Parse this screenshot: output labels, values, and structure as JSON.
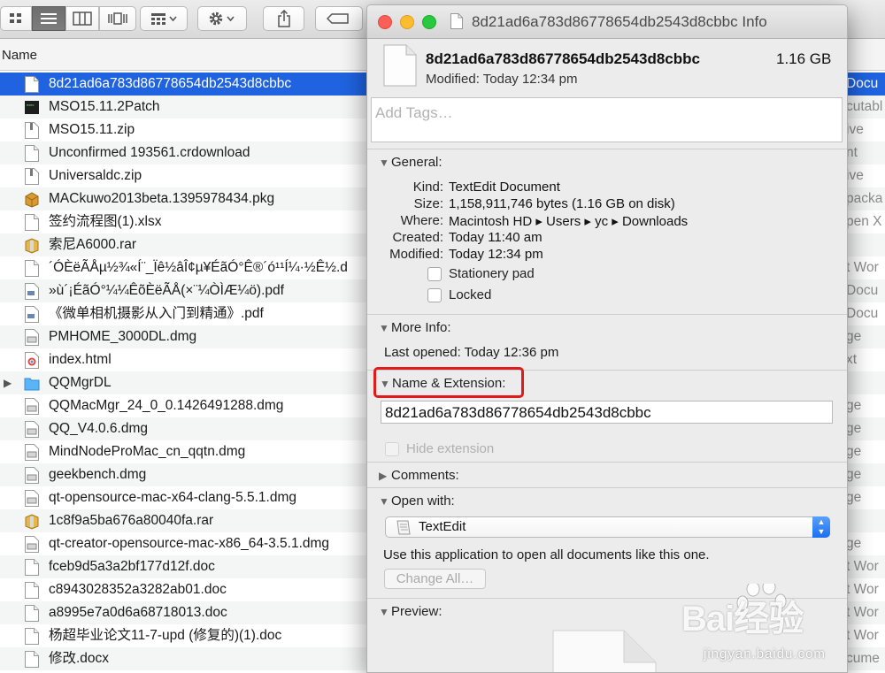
{
  "finder": {
    "column_header": "Name",
    "rows": [
      {
        "name": "8d21ad6a783d86778654db2543d8cbbc",
        "kind": "Docu",
        "icon": "document-icon",
        "selected": true
      },
      {
        "name": "MSO15.11.2Patch",
        "kind": "cutabl",
        "icon": "terminal-exec-icon"
      },
      {
        "name": "MSO15.11.zip",
        "kind": "ive",
        "icon": "zip-icon"
      },
      {
        "name": "Unconfirmed 193561.crdownload",
        "kind": "nt",
        "icon": "document-icon"
      },
      {
        "name": "Universaldc.zip",
        "kind": "ive",
        "icon": "zip-icon"
      },
      {
        "name": "MACkuwo2013beta.1395978434.pkg",
        "kind": "packa",
        "icon": "package-icon"
      },
      {
        "name": "签约流程图(1).xlsx",
        "kind": "pen X",
        "icon": "document-icon"
      },
      {
        "name": "索尼A6000.rar",
        "kind": "",
        "icon": "archive-box-icon"
      },
      {
        "name": "´ÓÈëÃÅµ½¾«Í¨_Ïê½âÎ¢µ¥ÉãÓ°Ê®´ó¹¹Í¼·½Ê½.d",
        "kind": "t Wor",
        "icon": "document-icon"
      },
      {
        "name": "»ù´¡ÉãÓ°¼¼ÊõÈëÃÅ(×¨¼ÒÌÆ¼ö).pdf",
        "kind": "Docu",
        "icon": "pdf-icon"
      },
      {
        "name": "《微单相机摄影从入门到精通》.pdf",
        "kind": "Docu",
        "icon": "pdf-icon"
      },
      {
        "name": "PMHOME_3000DL.dmg",
        "kind": "ge",
        "icon": "disk-image-icon"
      },
      {
        "name": "index.html",
        "kind": "xt",
        "icon": "chrome-html-icon"
      },
      {
        "name": "QQMgrDL",
        "kind": "",
        "icon": "folder-icon",
        "folder": true
      },
      {
        "name": "QQMacMgr_24_0_0.1426491288.dmg",
        "kind": "ge",
        "icon": "disk-image-icon"
      },
      {
        "name": "QQ_V4.0.6.dmg",
        "kind": "ge",
        "icon": "disk-image-icon"
      },
      {
        "name": "MindNodeProMac_cn_qqtn.dmg",
        "kind": "ge",
        "icon": "disk-image-icon"
      },
      {
        "name": "geekbench.dmg",
        "kind": "ge",
        "icon": "disk-image-icon"
      },
      {
        "name": "qt-opensource-mac-x64-clang-5.5.1.dmg",
        "kind": "ge",
        "icon": "disk-image-icon"
      },
      {
        "name": "1c8f9a5ba676a80040fa.rar",
        "kind": "",
        "icon": "archive-box-icon"
      },
      {
        "name": "qt-creator-opensource-mac-x86_64-3.5.1.dmg",
        "kind": "ge",
        "icon": "disk-image-icon"
      },
      {
        "name": "fceb9d5a3a2bf177d12f.doc",
        "kind": "t Wor",
        "icon": "document-icon"
      },
      {
        "name": "c8943028352a3282ab01.doc",
        "kind": "t Wor",
        "icon": "document-icon"
      },
      {
        "name": "a8995e7a0d6a68718013.doc",
        "kind": "t Wor",
        "icon": "document-icon"
      },
      {
        "name": "杨超毕业论文11-7-upd (修复的)(1).doc",
        "kind": "t Wor",
        "icon": "document-icon"
      },
      {
        "name": "修改.docx",
        "kind": "cume",
        "icon": "document-icon"
      }
    ]
  },
  "info_window": {
    "title": "8d21ad6a783d86778654db2543d8cbbc Info",
    "file_name": "8d21ad6a783d86778654db2543d8cbbc",
    "file_size": "1.16 GB",
    "modified_header": "Modified: Today 12:34 pm",
    "tags_placeholder": "Add Tags…",
    "general": {
      "title": "General:",
      "kind_label": "Kind:",
      "kind_value": "TextEdit Document",
      "size_label": "Size:",
      "size_value": "1,158,911,746 bytes (1.16 GB on disk)",
      "where_label": "Where:",
      "where_value": "Macintosh HD ▸ Users ▸ yc ▸ Downloads",
      "created_label": "Created:",
      "created_value": "Today 11:40 am",
      "modified_label": "Modified:",
      "modified_value": "Today 12:34 pm",
      "stationery_label": "Stationery pad",
      "locked_label": "Locked"
    },
    "more_info": {
      "title": "More Info:",
      "last_opened": "Last opened: Today 12:36 pm"
    },
    "name_extension": {
      "title": "Name & Extension:",
      "value": "8d21ad6a783d86778654db2543d8cbbc",
      "hide_extension": "Hide extension"
    },
    "comments": {
      "title": "Comments:"
    },
    "open_with": {
      "title": "Open with:",
      "app": "TextEdit",
      "description": "Use this application to open all documents like this one.",
      "change_all": "Change All…"
    },
    "preview": {
      "title": "Preview:"
    }
  },
  "watermark": {
    "brand": "Bai经验",
    "url": "jingyan.baidu.com"
  }
}
